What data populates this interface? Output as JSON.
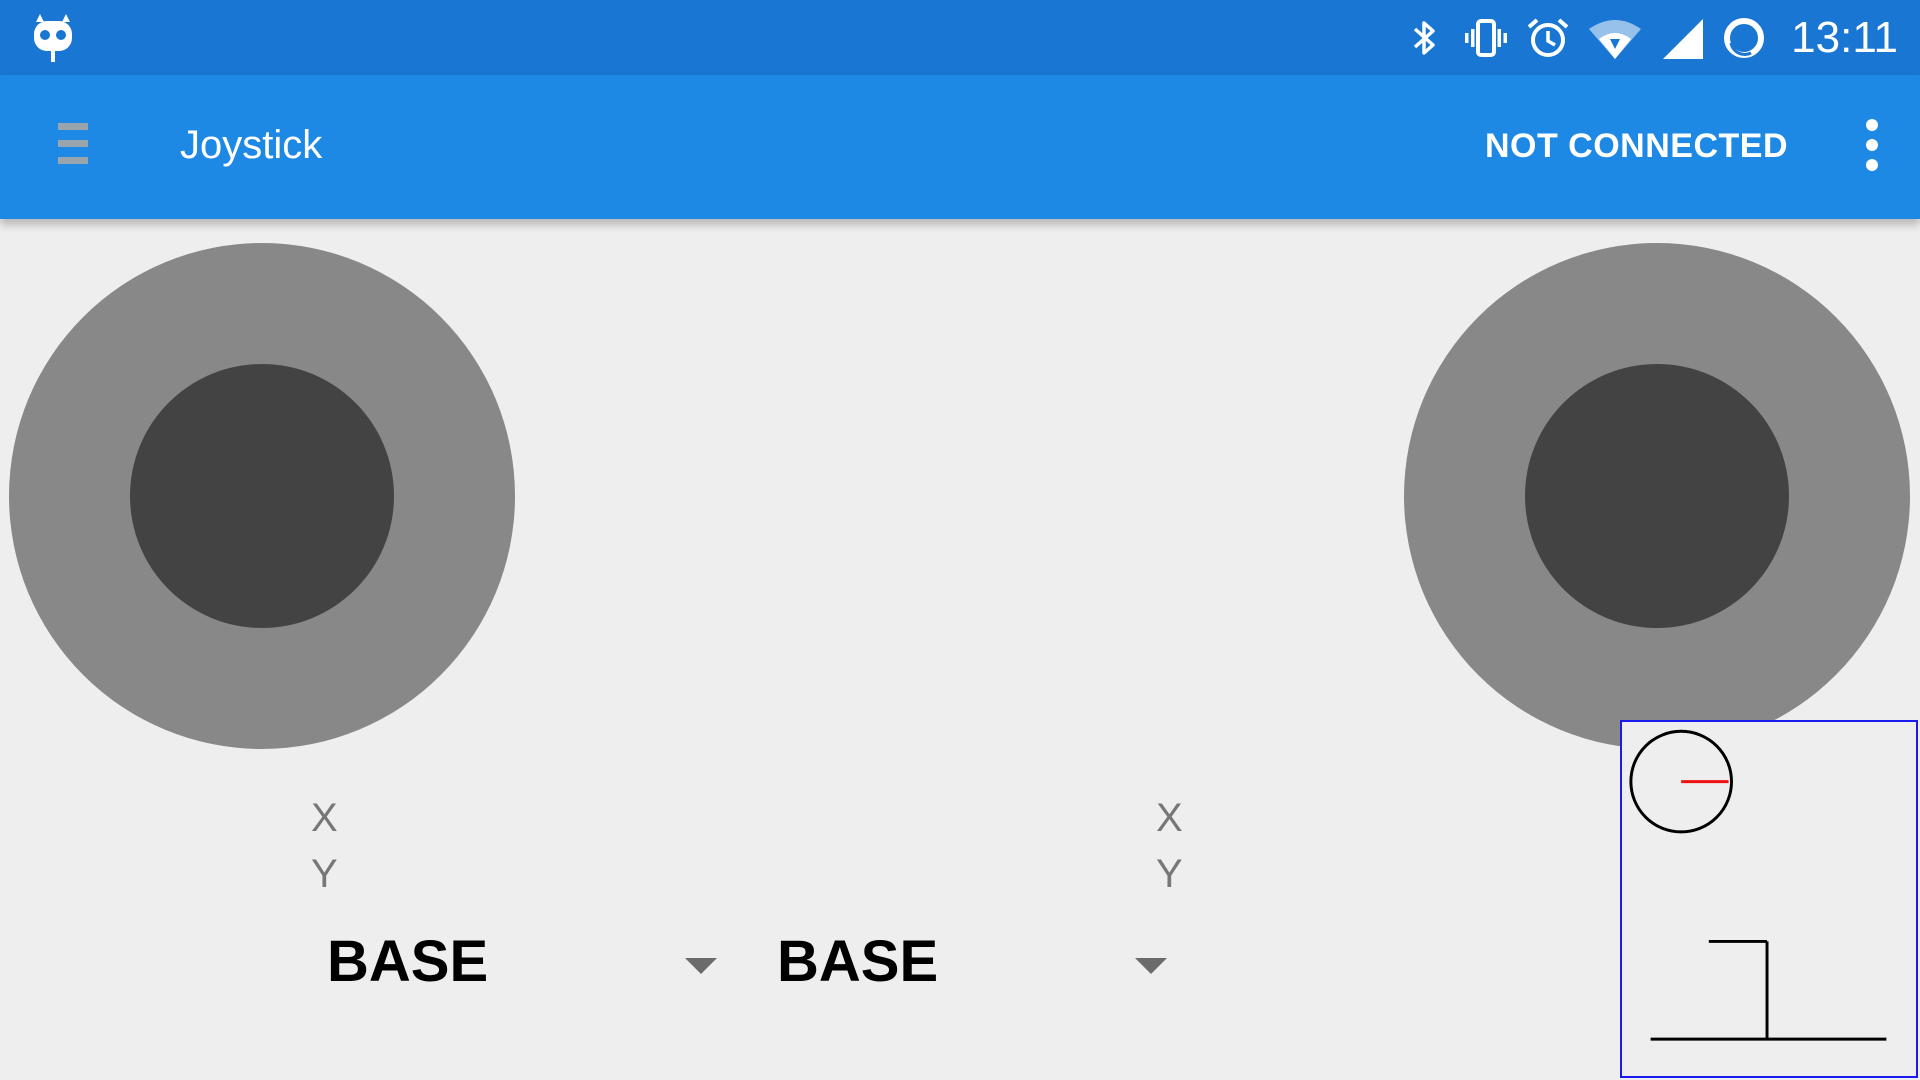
{
  "status_bar": {
    "time": "13:11",
    "icons": [
      "cyanogen-robot-icon",
      "bluetooth-icon",
      "vibrate-icon",
      "alarm-icon",
      "wifi-icon",
      "cell-signal-icon",
      "sync-circle-icon"
    ]
  },
  "app_bar": {
    "menu_icon": "hamburger-menu-icon",
    "title": "Joystick",
    "connection_status": "NOT CONNECTED",
    "overflow_icon": "more-vert-icon"
  },
  "joysticks": {
    "left": {
      "x_label": "X",
      "y_label": "Y"
    },
    "right": {
      "x_label": "X",
      "y_label": "Y"
    }
  },
  "dropdowns": {
    "left": {
      "selected": "BASE"
    },
    "right": {
      "selected": "BASE"
    }
  },
  "visualization": {
    "border_color": "#1a1aee",
    "indicator_color": "#ee1111"
  },
  "colors": {
    "status_bar": "#1976d2",
    "app_bar": "#1e88e5",
    "background": "#eeeeee",
    "joystick_base": "#888888",
    "joystick_knob": "#434343"
  }
}
